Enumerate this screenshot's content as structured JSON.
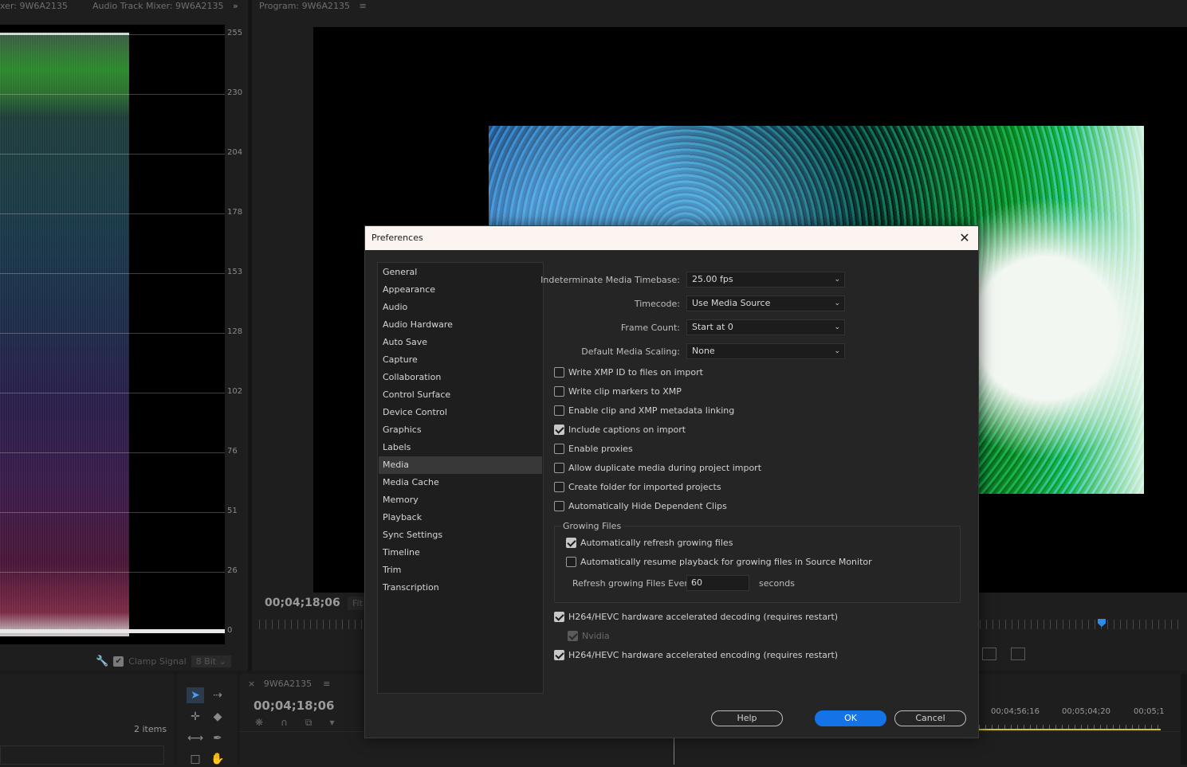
{
  "scopes": {
    "tabs": [
      "xer: 9W6A2135",
      "Audio Track Mixer: 9W6A2135"
    ],
    "overflow_icon": "double-chevron-right-icon",
    "scale": [
      "255",
      "230",
      "204",
      "178",
      "153",
      "128",
      "102",
      "76",
      "51",
      "26",
      "0"
    ],
    "clamp_label": "Clamp Signal",
    "bit_depth": "8 Bit"
  },
  "program": {
    "tab": "Program: 9W6A2135",
    "timecode": "00;04;18;06",
    "fit": "Fit"
  },
  "project": {
    "items": "2 items"
  },
  "timeline": {
    "tab": "9W6A2135",
    "timecode": "00;04;18;06",
    "times": [
      "00;04;56;16",
      "00;05;04;20",
      "00;05;1"
    ]
  },
  "dialog": {
    "title": "Preferences",
    "sidebar": [
      "General",
      "Appearance",
      "Audio",
      "Audio Hardware",
      "Auto Save",
      "Capture",
      "Collaboration",
      "Control Surface",
      "Device Control",
      "Graphics",
      "Labels",
      "Media",
      "Media Cache",
      "Memory",
      "Playback",
      "Sync Settings",
      "Timeline",
      "Trim",
      "Transcription"
    ],
    "active_item": "Media",
    "fields": {
      "timebase_label": "Indeterminate Media Timebase:",
      "timebase_value": "25.00 fps",
      "timecode_label": "Timecode:",
      "timecode_value": "Use Media Source",
      "framecount_label": "Frame Count:",
      "framecount_value": "Start at 0",
      "scaling_label": "Default Media Scaling:",
      "scaling_value": "None"
    },
    "checkboxes": [
      {
        "label": "Write XMP ID to files on import",
        "checked": false
      },
      {
        "label": "Write clip markers to XMP",
        "checked": false
      },
      {
        "label": "Enable clip and XMP metadata linking",
        "checked": false
      },
      {
        "label": "Include captions on import",
        "checked": true
      },
      {
        "label": "Enable proxies",
        "checked": false
      },
      {
        "label": "Allow duplicate media during project import",
        "checked": false
      },
      {
        "label": "Create folder for imported projects",
        "checked": false
      },
      {
        "label": "Automatically Hide Dependent Clips",
        "checked": false
      }
    ],
    "growing": {
      "title": "Growing Files",
      "auto_refresh": "Automatically refresh growing files",
      "auto_resume": "Automatically resume playback for growing files in Source Monitor",
      "refresh_label": "Refresh growing Files Every",
      "refresh_value": "60",
      "refresh_unit": "seconds"
    },
    "hw_decode": "H264/HEVC hardware accelerated decoding (requires restart)",
    "nvidia": "Nvidia",
    "hw_encode": "H264/HEVC hardware accelerated encoding (requires restart)",
    "buttons": {
      "help": "Help",
      "ok": "OK",
      "cancel": "Cancel"
    },
    "colors": {
      "accent": "#1473e6",
      "titlebar": "#fbf4f1"
    }
  }
}
